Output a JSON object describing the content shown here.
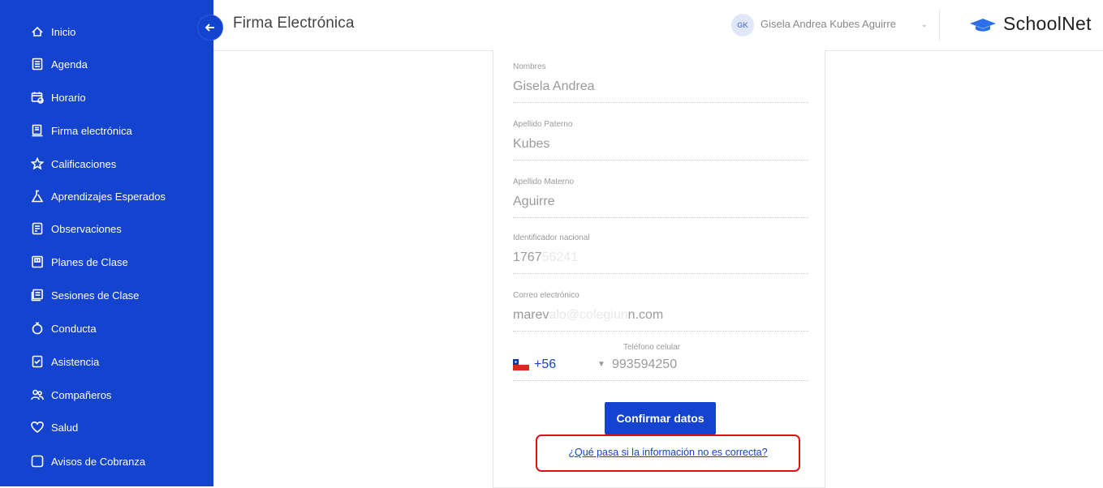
{
  "sidebar": {
    "items": [
      {
        "label": "Inicio",
        "icon": "home-icon"
      },
      {
        "label": "Agenda",
        "icon": "agenda-icon"
      },
      {
        "label": "Horario",
        "icon": "calendar-clock-icon"
      },
      {
        "label": "Firma electrónica",
        "icon": "signature-document-icon"
      },
      {
        "label": "Calificaciones",
        "icon": "star-icon"
      },
      {
        "label": "Aprendizajes Esperados",
        "icon": "flask-icon"
      },
      {
        "label": "Observaciones",
        "icon": "note-icon"
      },
      {
        "label": "Planes de Clase",
        "icon": "plan-icon"
      },
      {
        "label": "Sesiones de Clase",
        "icon": "sessions-icon"
      },
      {
        "label": "Conducta",
        "icon": "stopwatch-icon"
      },
      {
        "label": "Asistencia",
        "icon": "attendance-icon"
      },
      {
        "label": "Compañeros",
        "icon": "people-icon"
      },
      {
        "label": "Salud",
        "icon": "heart-icon"
      },
      {
        "label": "Avisos de Cobranza",
        "icon": "square-icon"
      }
    ]
  },
  "header": {
    "title": "Firma Electrónica",
    "user_initials": "GK",
    "user_name": "Gisela Andrea Kubes Aguirre",
    "brand": "SchoolNet"
  },
  "form": {
    "nombres": {
      "label": "Nombres",
      "value": "Gisela Andrea"
    },
    "apellido_paterno": {
      "label": "Apellido Paterno",
      "value": "Kubes"
    },
    "apellido_materno": {
      "label": "Apellido Materno",
      "value": "Aguirre"
    },
    "identificador": {
      "label": "Identificador nacional",
      "value_visible": "1767",
      "value_faded": "56241"
    },
    "correo": {
      "label": "Correo electrónico",
      "value_visible_start": "marev",
      "value_faded": "alo@colegiun",
      "value_visible_end": "n.com"
    },
    "telefono": {
      "label": "Teléfono celular",
      "country_code": "+56",
      "value": "993594250"
    },
    "confirm_label": "Confirmar datos",
    "help_link": "¿Qué pasa si la información no es correcta?"
  },
  "colors": {
    "primary": "#1443cf",
    "highlight": "#e0101a"
  }
}
